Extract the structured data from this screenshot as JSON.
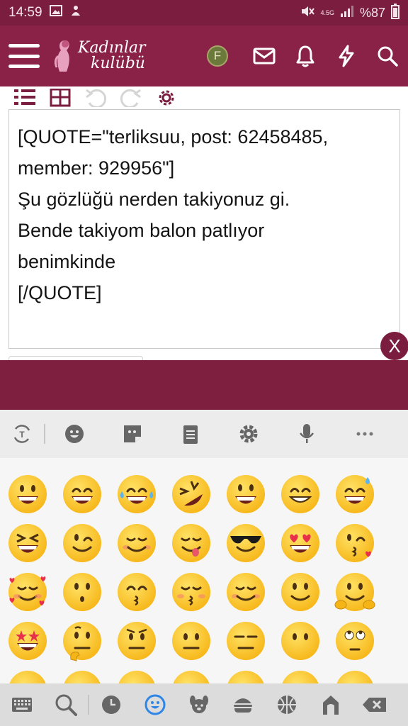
{
  "status_bar": {
    "time": "14:59",
    "network": "4.5G",
    "battery": "%87"
  },
  "header": {
    "logo_line1": "Kadınlar",
    "logo_line2": "kulübü",
    "avatar_letter": "F"
  },
  "editor": {
    "content": "[QUOTE=\"terliksuu, post: 62458485,\nmember: 929956\"]\nŞu gözlüğü nerden takiyonuz gi.\nBende takiyom balon patlıyor\nbenimkinde\n[/QUOTE]",
    "close_label": "X"
  },
  "keyboard": {
    "toolbar_icons": [
      "translate-icon",
      "emoji-icon",
      "sticker-icon",
      "clipboard-icon",
      "gear-icon",
      "microphone-icon",
      "more-icon"
    ],
    "emoji_rows": [
      [
        "grinning",
        "beaming",
        "tears-of-joy",
        "rofl",
        "smiley",
        "grin",
        "sweat-smile"
      ],
      [
        "squinting",
        "winking",
        "blushing",
        "yum",
        "sunglasses",
        "heart-eyes",
        "kissing-heart"
      ],
      [
        "smiling-hearts",
        "kissing",
        "kissing-smiling-eyes",
        "kissing-closed-eyes",
        "relieved",
        "slight-smile",
        "hugging"
      ],
      [
        "star-struck",
        "thinking",
        "raised-eyebrow",
        "neutral",
        "expressionless",
        "no-mouth",
        "rolling-eyes"
      ],
      [
        "partial",
        "partial",
        "partial",
        "partial",
        "partial",
        "partial",
        "partial"
      ]
    ],
    "categories": [
      "keyboard-icon",
      "search-icon",
      "recent-icon",
      "smileys-icon",
      "animals-icon",
      "food-icon",
      "activity-icon",
      "travel-icon",
      "backspace-icon"
    ]
  }
}
